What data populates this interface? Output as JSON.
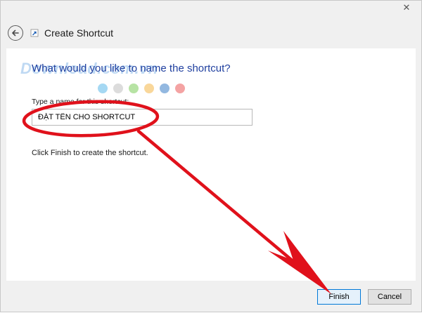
{
  "window": {
    "title": "Create Shortcut",
    "close_glyph": "✕"
  },
  "main": {
    "heading": "What would you like to name the shortcut?",
    "field_label": "Type a name for this shortcut:",
    "name_value": "ĐẶT TÊN CHO SHORTCUT",
    "info": "Click Finish to create the shortcut."
  },
  "buttons": {
    "finish": "Finish",
    "cancel": "Cancel"
  },
  "watermark": {
    "text": "Download.com.vn",
    "dot_colors": [
      "#a5d8f3",
      "#dcdcdc",
      "#b7e3a4",
      "#f9d79a",
      "#93b8e0",
      "#f4a3a3"
    ]
  },
  "colors": {
    "heading": "#1f3f9f",
    "annotation": "#e0111b",
    "finish_border": "#0078d7"
  },
  "icons": {
    "close": "close-icon",
    "back": "back-arrow-icon",
    "wizard": "shortcut-wizard-icon"
  }
}
